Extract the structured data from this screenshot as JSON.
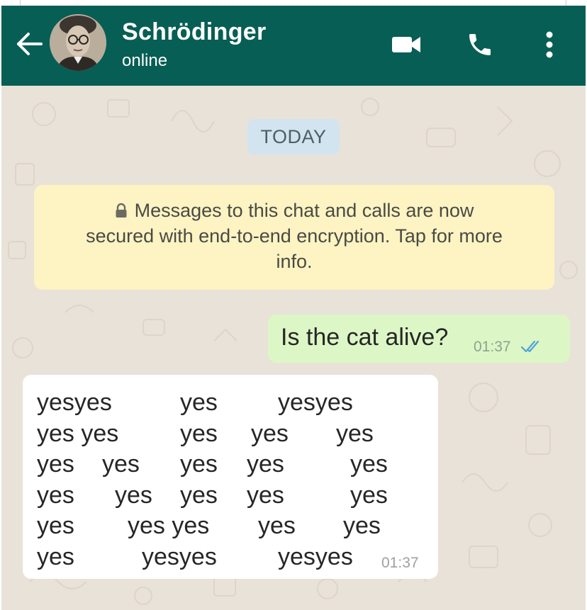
{
  "colors": {
    "header": "#075e54",
    "chat_background": "#e9e2d8",
    "outgoing_bubble": "#dcf7c5",
    "incoming_bubble": "#ffffff",
    "encryption_notice": "#fdf3c3",
    "date_pill": "#d2e4ef",
    "read_ticks": "#4fa3d8"
  },
  "header": {
    "back_icon": "arrow-left-icon",
    "contact_name": "Schrödinger",
    "status": "online",
    "icons": [
      "video-camera-icon",
      "phone-icon",
      "more-vert-icon"
    ]
  },
  "chat": {
    "date_label": "TODAY",
    "encryption_notice": {
      "icon": "lock-icon",
      "line1": "Messages to this chat and calls are now",
      "line2": "secured with end-to-end encryption. Tap for more",
      "line3": "info."
    },
    "outgoing_message": {
      "text": "Is the cat alive?",
      "time": "01:37",
      "status_icon": "double-check-read-icon"
    },
    "incoming_message": {
      "lines": [
        [
          "yesyes",
          "yes",
          "yesyes"
        ],
        [
          "yes yes",
          "yes",
          "yes",
          "yes"
        ],
        [
          "yes",
          "yes",
          "yes",
          "yes",
          "yes"
        ],
        [
          "yes",
          "yes",
          "yes",
          "yes",
          "yes"
        ],
        [
          "yes",
          "yes yes",
          "yes",
          "yes"
        ],
        [
          "yes",
          "yesyes",
          "yesyes"
        ]
      ],
      "time": "01:37"
    }
  }
}
